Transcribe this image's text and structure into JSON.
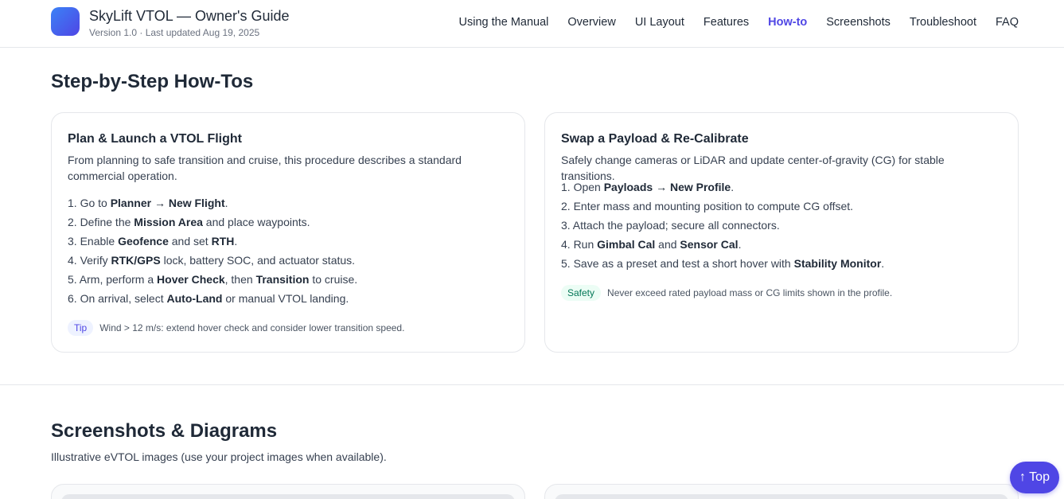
{
  "header": {
    "title": "SkyLift VTOL — Owner's Guide",
    "subtitle": "Version 1.0 · Last updated Aug 19, 2025",
    "logo_icon": "gradient-square-logo",
    "nav": [
      {
        "label": "Using the Manual",
        "active": false
      },
      {
        "label": "Overview",
        "active": false
      },
      {
        "label": "UI Layout",
        "active": false
      },
      {
        "label": "Features",
        "active": false
      },
      {
        "label": "How-to",
        "active": true
      },
      {
        "label": "Screenshots",
        "active": false
      },
      {
        "label": "Troubleshoot",
        "active": false
      },
      {
        "label": "FAQ",
        "active": false
      }
    ]
  },
  "howto": {
    "title": "Step-by-Step How-Tos",
    "cards": [
      {
        "title": "Plan & Launch a VTOL Flight",
        "description": "From planning to safe transition and cruise, this procedure describes a standard commercial operation.",
        "steps": [
          [
            {
              "t": "1. Go to "
            },
            {
              "t": "Planner → New Flight",
              "b": true
            },
            {
              "t": "."
            }
          ],
          [
            {
              "t": "2. Define the "
            },
            {
              "t": "Mission Area",
              "b": true
            },
            {
              "t": " and place waypoints."
            }
          ],
          [
            {
              "t": "3. Enable "
            },
            {
              "t": "Geofence",
              "b": true
            },
            {
              "t": " and set "
            },
            {
              "t": "RTH",
              "b": true
            },
            {
              "t": "."
            }
          ],
          [
            {
              "t": "4. Verify "
            },
            {
              "t": "RTK/GPS",
              "b": true
            },
            {
              "t": " lock, battery SOC, and actuator status."
            }
          ],
          [
            {
              "t": "5. Arm, perform a "
            },
            {
              "t": "Hover Check",
              "b": true
            },
            {
              "t": ", then "
            },
            {
              "t": "Transition",
              "b": true
            },
            {
              "t": " to cruise."
            }
          ],
          [
            {
              "t": "6. On arrival, select "
            },
            {
              "t": "Auto-Land",
              "b": true
            },
            {
              "t": " or manual VTOL landing."
            }
          ]
        ],
        "badge": "Tip",
        "note": "Wind > 12 m/s: extend hover check and consider lower transition speed."
      },
      {
        "title": "Swap a Payload & Re-Calibrate",
        "description": "Safely change cameras or LiDAR and update center-of-gravity (CG) for stable transitions.",
        "steps": [
          [
            {
              "t": "1. Open "
            },
            {
              "t": "Payloads → New Profile",
              "b": true
            },
            {
              "t": "."
            }
          ],
          [
            {
              "t": "2. Enter mass and mounting position to compute CG offset."
            }
          ],
          [
            {
              "t": "3. Attach the payload; secure all connectors."
            }
          ],
          [
            {
              "t": "4. Run "
            },
            {
              "t": "Gimbal Cal",
              "b": true
            },
            {
              "t": " and "
            },
            {
              "t": "Sensor Cal",
              "b": true
            },
            {
              "t": "."
            }
          ],
          [
            {
              "t": "5. Save as a preset and test a short hover with "
            },
            {
              "t": "Stability Monitor",
              "b": true
            },
            {
              "t": "."
            }
          ]
        ],
        "badge": "Safety",
        "note": "Never exceed rated payload mass or CG limits shown in the profile."
      }
    ]
  },
  "screenshots": {
    "title": "Screenshots & Diagrams",
    "subtitle": "Illustrative eVTOL images (use your project images when available)."
  },
  "back_to_top": {
    "label": "↑ Top"
  },
  "colors": {
    "accent": "#4f46e5",
    "text": "#1f2937",
    "border": "#e5e7eb",
    "safety": "#047857"
  }
}
